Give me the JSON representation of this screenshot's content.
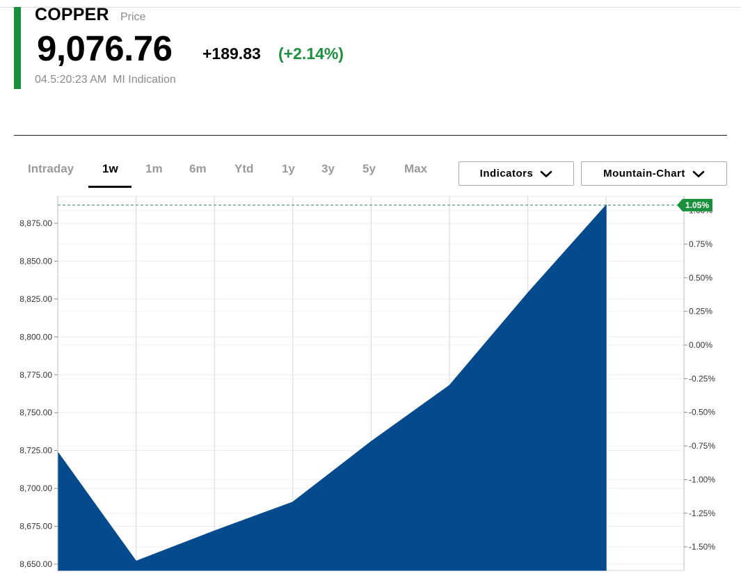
{
  "header": {
    "ticker": "COPPER",
    "price_label": "Price",
    "price": "9,076.76",
    "change": "+189.83",
    "change_pct": "(+2.14%)",
    "timestamp": "04.5:20:23 AM",
    "indication": "MI Indication",
    "up_color": "#1a8f3c"
  },
  "tabs": [
    {
      "label": "Intraday",
      "active": false
    },
    {
      "label": "1w",
      "active": true
    },
    {
      "label": "1m",
      "active": false
    },
    {
      "label": "6m",
      "active": false
    },
    {
      "label": "Ytd",
      "active": false
    },
    {
      "label": "1y",
      "active": false
    },
    {
      "label": "3y",
      "active": false
    },
    {
      "label": "5y",
      "active": false
    },
    {
      "label": "Max",
      "active": false
    }
  ],
  "controls": {
    "indicators_label": "Indicators",
    "chart_type_label": "Mountain-Chart",
    "chevron_icon": "chevron-down-icon"
  },
  "chart_data": {
    "type": "area",
    "color": "#044a8c",
    "x_count": 8,
    "values": [
      8724,
      8652,
      8672,
      8691,
      8731,
      8768,
      8829,
      8887
    ],
    "ylim": [
      8650,
      8887
    ],
    "y_ticks": [
      "8,875.00",
      "8,850.00",
      "8,825.00",
      "8,800.00",
      "8,775.00",
      "8,750.00",
      "8,725.00",
      "8,700.00",
      "8,675.00",
      "8,650.00"
    ],
    "y_tick_values": [
      8875,
      8850,
      8825,
      8800,
      8775,
      8750,
      8725,
      8700,
      8675,
      8650
    ],
    "y2_ticks": [
      "1.00%",
      "0.75%",
      "0.50%",
      "0.25%",
      "0.00%",
      "-0.25%",
      "-0.50%",
      "-0.75%",
      "-1.00%",
      "-1.25%",
      "-1.50%"
    ],
    "y2_tick_values": [
      1.0,
      0.75,
      0.5,
      0.25,
      0.0,
      -0.25,
      -0.5,
      -0.75,
      -1.0,
      -1.25,
      -1.5
    ],
    "y2lim": [
      -1.625,
      1.05
    ],
    "last_value_label": "1.05%",
    "last_value_color": "#1a8f3c",
    "grid": true
  }
}
